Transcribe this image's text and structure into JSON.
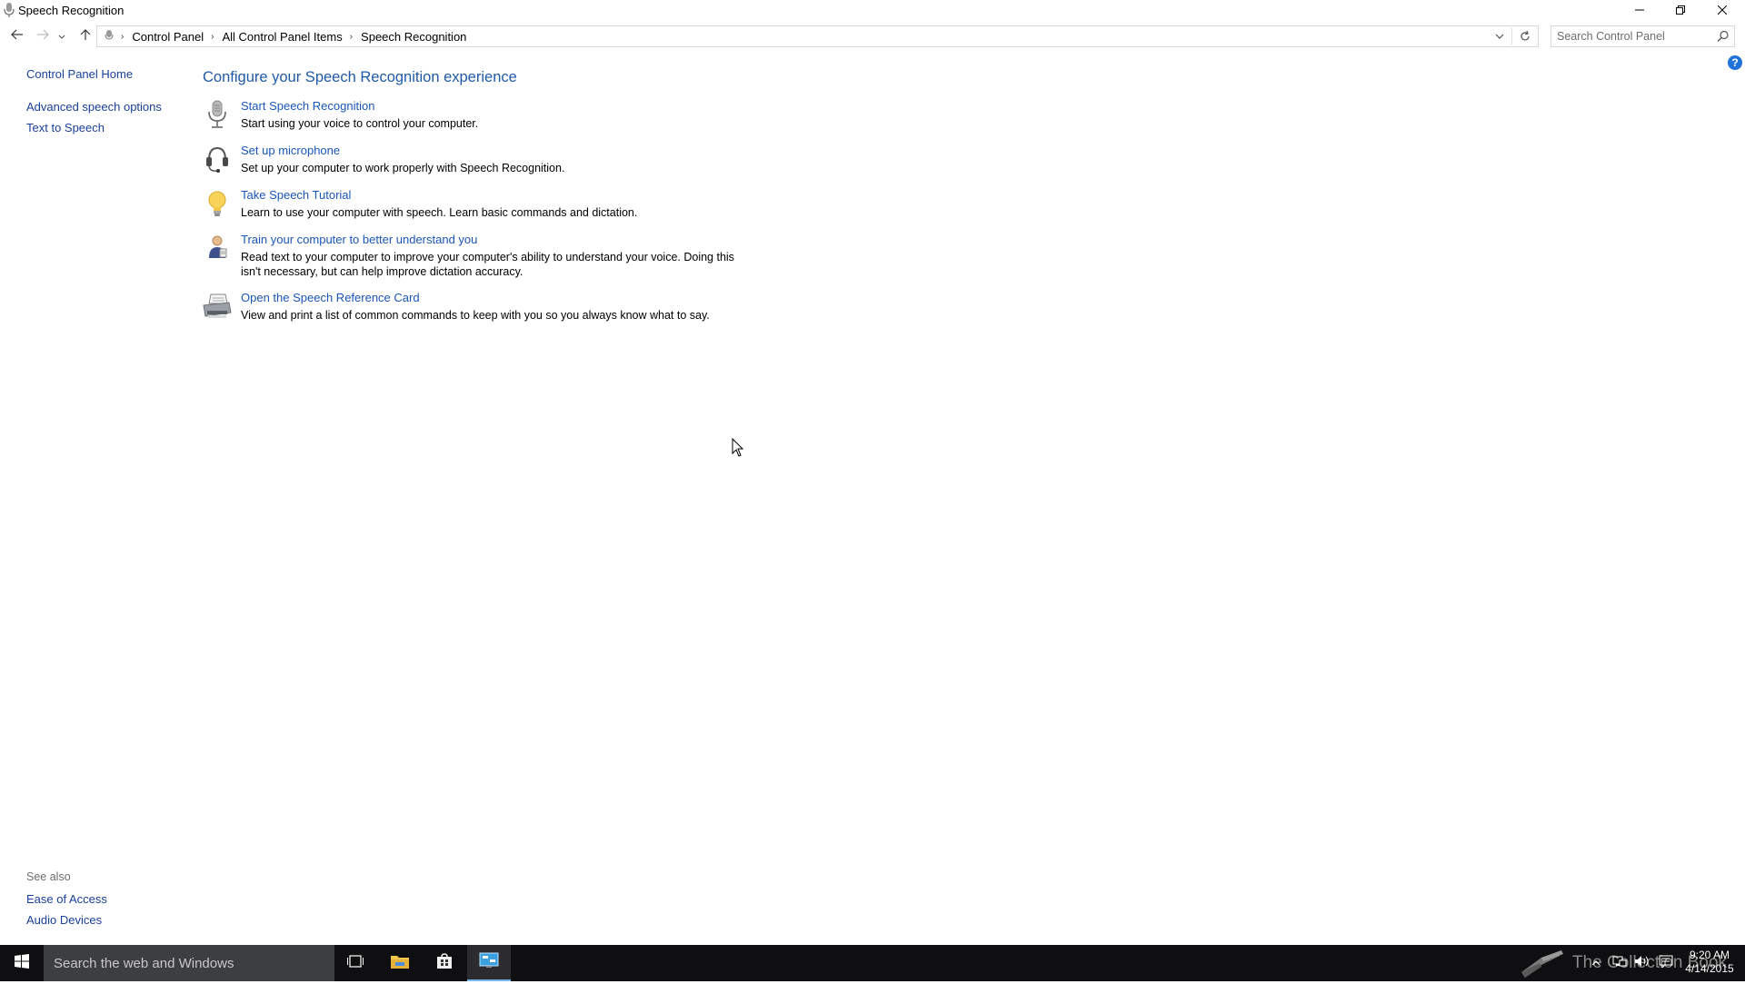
{
  "window": {
    "title": "Speech Recognition",
    "controls": {
      "minimize": "minimize-icon",
      "maximize": "restore-icon",
      "close": "close-icon"
    }
  },
  "address": {
    "breadcrumbs": [
      "Control Panel",
      "All Control Panel Items",
      "Speech Recognition"
    ],
    "search_placeholder": "Search Control Panel"
  },
  "sidebar": {
    "home": "Control Panel Home",
    "links": [
      "Advanced speech options",
      "Text to Speech"
    ],
    "see_also_label": "See also",
    "see_also": [
      "Ease of Access",
      "Audio Devices"
    ]
  },
  "main": {
    "title": "Configure your Speech Recognition experience",
    "tasks": [
      {
        "link": "Start Speech Recognition",
        "desc": "Start using your voice to control your computer.",
        "icon": "microphone-icon"
      },
      {
        "link": "Set up microphone",
        "desc": "Set up your computer to work properly with Speech Recognition.",
        "icon": "headset-icon"
      },
      {
        "link": "Take Speech Tutorial",
        "desc": "Learn to use your computer with speech.  Learn basic commands and dictation.",
        "icon": "lightbulb-icon"
      },
      {
        "link": "Train your computer to better understand you",
        "desc": "Read text to your computer to improve your computer's ability to understand your voice.  Doing this isn't necessary, but can help improve dictation accuracy.",
        "icon": "user-training-icon"
      },
      {
        "link": "Open the Speech Reference Card",
        "desc": "View and print a list of common commands to keep with you so you always know what to say.",
        "icon": "printer-icon"
      }
    ]
  },
  "help": "?",
  "taskbar": {
    "search_text": "Search the web and Windows",
    "clock_time": "9:20 AM",
    "clock_date": "4/14/2015",
    "watermark": "The Collection Book"
  },
  "colors": {
    "link": "#1a56b8",
    "title": "#1e5aa8",
    "taskbar": "#0f0f12",
    "accent": "#76b9ed"
  }
}
